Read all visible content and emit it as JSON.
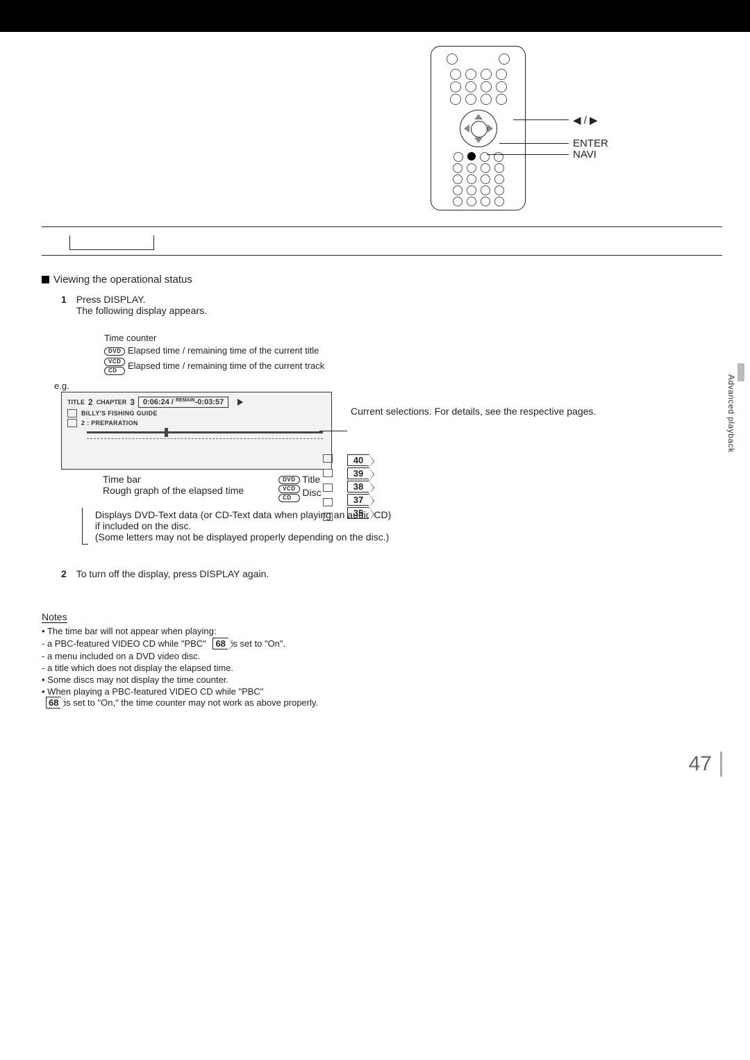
{
  "page_number": "47",
  "side_tab": "Advanced playback",
  "remote": {
    "labels": {
      "arrows": "◀ / ▶",
      "enter": "ENTER",
      "navi": "NAVI"
    }
  },
  "section": {
    "heading": "Viewing the operational status",
    "step1": {
      "num": "1",
      "line1": "Press DISPLAY.",
      "line2": "The following display appears."
    },
    "time_counter": {
      "title": "Time counter",
      "dvd_line": "Elapsed time / remaining time of the current title",
      "vcd_line": "Elapsed time / remaining time of the current track"
    },
    "eg_label": "e.g.",
    "osd": {
      "title_lbl": "TITLE",
      "title_num": "2",
      "chapter_lbl": "CHAPTER",
      "chapter_num": "3",
      "elapsed": "0:06:24",
      "sep": "/",
      "remain_lbl": "REMAIN",
      "remain": "-0:03:57",
      "text_line1": "BILLY'S FISHING GUIDE",
      "text_line2": "2 : PREPARATION"
    },
    "current_sel": "Current selections. For details, see the respective pages.",
    "page_refs": [
      "40",
      "39",
      "38",
      "37",
      "35"
    ],
    "below": {
      "timebar_label": "Time bar",
      "rough_label": "Rough graph of the elapsed time",
      "dvd_word": "Title",
      "vcd_word": "Disc"
    },
    "legend": {
      "l1": "Displays DVD-Text data (or CD-Text data when playing an audio CD)",
      "l2": "if included on the disc.",
      "l3": "(Some letters may not be displayed properly depending on the disc.)"
    },
    "step2": {
      "num": "2",
      "text": "To turn off the display, press DISPLAY again."
    }
  },
  "notes": {
    "title": "Notes",
    "items": {
      "n1": "The time bar will not appear when playing:",
      "n1a_pre": "- a PBC-featured VIDEO CD while \"PBC\"",
      "n1a_ref": "68",
      "n1a_post": " is set to \"On\".",
      "n1b": "- a menu included on a DVD video disc.",
      "n1c": "- a title which does not display the elapsed time.",
      "n2": "Some discs may not display the time counter.",
      "n3_pre": "When playing a PBC-featured VIDEO CD while \"PBC\"",
      "n3_ref": "68",
      "n3_post": " is set to \"On,\" the time counter may not work as above properly."
    }
  },
  "pills": {
    "dvd": "DVD",
    "vcd": "VCD",
    "cd": "CD"
  }
}
